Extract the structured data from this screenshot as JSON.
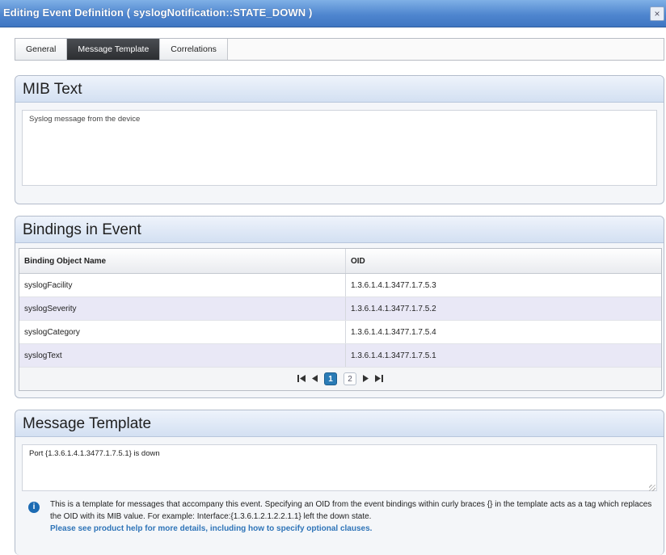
{
  "window": {
    "title": "Editing Event Definition ( syslogNotification::STATE_DOWN )",
    "close_label": "×"
  },
  "tabs": [
    {
      "label": "General",
      "active": false
    },
    {
      "label": "Message Template",
      "active": true
    },
    {
      "label": "Correlations",
      "active": false
    }
  ],
  "mib_text": {
    "heading": "MIB Text",
    "value": "Syslog message from the device"
  },
  "bindings": {
    "heading": "Bindings in Event",
    "columns": [
      "Binding Object Name",
      "OID"
    ],
    "rows": [
      [
        "syslogFacility",
        "1.3.6.1.4.1.3477.1.7.5.3"
      ],
      [
        "syslogSeverity",
        "1.3.6.1.4.1.3477.1.7.5.2"
      ],
      [
        "syslogCategory",
        "1.3.6.1.4.1.3477.1.7.5.4"
      ],
      [
        "syslogText",
        "1.3.6.1.4.1.3477.1.7.5.1"
      ]
    ],
    "pager": {
      "first_icon": "first-page-icon",
      "prev_icon": "prev-page-icon",
      "next_icon": "next-page-icon",
      "last_icon": "last-page-icon",
      "pages": [
        "1",
        "2"
      ],
      "current_page": "1"
    }
  },
  "message_template": {
    "heading": "Message Template",
    "value": "Port {1.3.6.1.4.1.3477.1.7.5.1} is down",
    "info_text": "This is a template for messages that accompany this event. Specifying an OID from the event bindings within curly braces {} in the template acts as a tag which replaces the OID with its MIB value. For example: Interface:{1.3.6.1.2.1.2.2.1.1} left the down state.",
    "info_link": "Please see product help for more details, including how to specify optional clauses."
  },
  "colors": {
    "titlebar": "#4f86cf",
    "active_tab": "#2c2e31",
    "link": "#2e74b8",
    "current_page": "#2a7bb6"
  }
}
